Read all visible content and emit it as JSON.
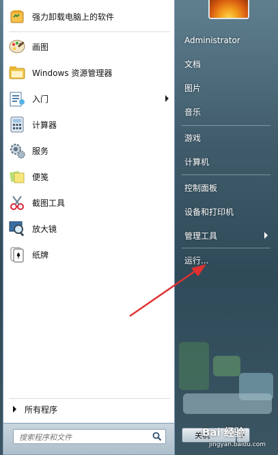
{
  "left_menu": {
    "items": [
      {
        "label": "强力卸载电脑上的软件",
        "icon": "uninstall-icon",
        "has_submenu": false
      },
      {
        "label": "画图",
        "icon": "paint-icon",
        "has_submenu": false
      },
      {
        "label": "Windows 资源管理器",
        "icon": "explorer-icon",
        "has_submenu": false
      },
      {
        "label": "入门",
        "icon": "getting-started-icon",
        "has_submenu": true
      },
      {
        "label": "计算器",
        "icon": "calculator-icon",
        "has_submenu": false
      },
      {
        "label": "服务",
        "icon": "services-icon",
        "has_submenu": false
      },
      {
        "label": "便笺",
        "icon": "sticky-notes-icon",
        "has_submenu": false
      },
      {
        "label": "截图工具",
        "icon": "snipping-tool-icon",
        "has_submenu": false
      },
      {
        "label": "放大镜",
        "icon": "magnifier-icon",
        "has_submenu": false
      },
      {
        "label": "纸牌",
        "icon": "solitaire-icon",
        "has_submenu": false
      }
    ],
    "all_programs_label": "所有程序"
  },
  "search": {
    "placeholder": "搜索程序和文件"
  },
  "right_menu": {
    "user": "Administrator",
    "items": [
      {
        "label": "文档",
        "has_submenu": false
      },
      {
        "label": "图片",
        "has_submenu": false
      },
      {
        "label": "音乐",
        "has_submenu": false
      },
      {
        "label": "游戏",
        "has_submenu": false
      },
      {
        "label": "计算机",
        "has_submenu": false
      },
      {
        "label": "控制面板",
        "has_submenu": false
      },
      {
        "label": "设备和打印机",
        "has_submenu": false
      },
      {
        "label": "管理工具",
        "has_submenu": true
      },
      {
        "label": "运行...",
        "has_submenu": false
      }
    ]
  },
  "shutdown": {
    "label": "关机"
  },
  "watermark": {
    "brand": "Bai 经验",
    "url": "jingyan.baidu.com"
  },
  "colors": {
    "annotation_arrow": "#e03030",
    "pane_border": "#7f9db9"
  }
}
